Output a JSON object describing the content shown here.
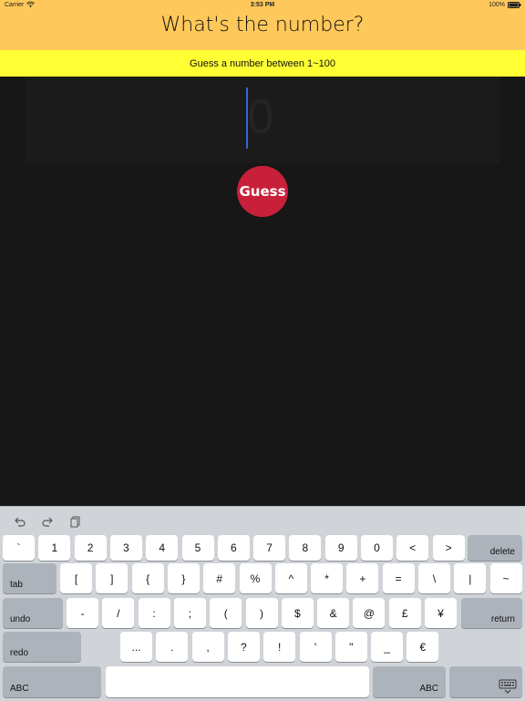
{
  "status_bar": {
    "carrier": "Carrier",
    "time": "3:53 PM",
    "battery": "100%"
  },
  "header": {
    "title": "What's the number?"
  },
  "banner": {
    "text": "Guess a number between 1~100"
  },
  "input": {
    "placeholder": "0"
  },
  "guess_button": {
    "label": "Guess"
  },
  "colors": {
    "header_bg": "#ffc85a",
    "banner_bg": "#ffff33",
    "background": "#171717",
    "button": "#c8203a",
    "cursor": "#3467d6"
  },
  "keyboard": {
    "toolbar": [
      "undo-arrow-icon",
      "redo-arrow-icon",
      "paste-icon"
    ],
    "row1": [
      "`",
      "1",
      "2",
      "3",
      "4",
      "5",
      "6",
      "7",
      "8",
      "9",
      "0",
      "<",
      ">"
    ],
    "delete": "delete",
    "tab": "tab",
    "row2": [
      "[",
      "]",
      "{",
      "}",
      "#",
      "%",
      "^",
      "*",
      "+",
      "=",
      "\\",
      "|",
      "~"
    ],
    "undo": "undo",
    "row3": [
      "-",
      "/",
      ":",
      ";",
      "(",
      ")",
      "$",
      "&",
      "@",
      "£",
      "¥"
    ],
    "return": "return",
    "redo": "redo",
    "row4": [
      "...",
      ".",
      ",",
      "?",
      "!",
      "'",
      "\"",
      "_",
      "€"
    ],
    "abc_left": "ABC",
    "abc_right": "ABC",
    "hide_keyboard": "keyboard-dismiss-icon"
  }
}
